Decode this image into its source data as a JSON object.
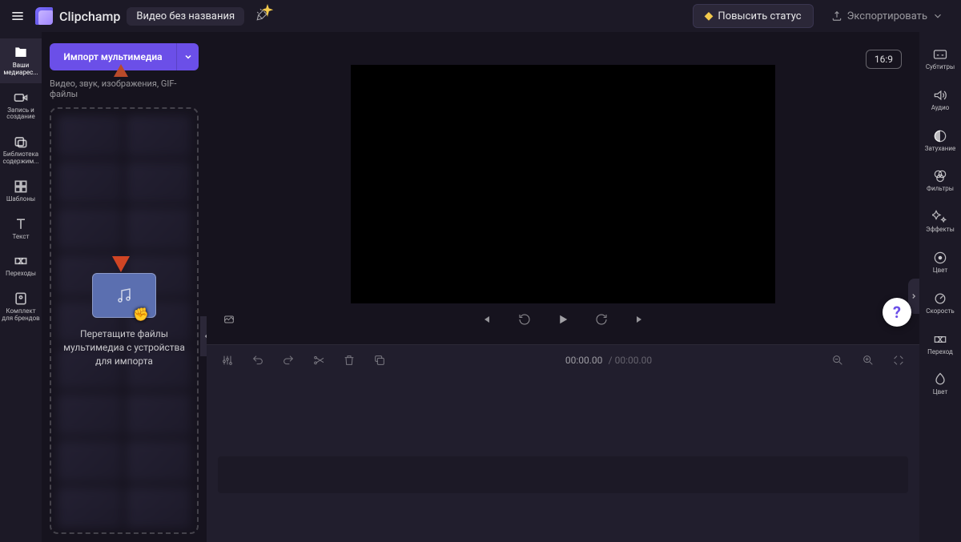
{
  "brand": "Clipchamp",
  "project_title": "Видео без названия",
  "header": {
    "upgrade": "Повысить статус",
    "export": "Экспортировать"
  },
  "left_rail": [
    {
      "key": "media",
      "label": "Ваши медиарес..."
    },
    {
      "key": "record",
      "label": "Запись и создание"
    },
    {
      "key": "library",
      "label": "Библиотека содержим..."
    },
    {
      "key": "templates",
      "label": "Шаблоны"
    },
    {
      "key": "text",
      "label": "Текст"
    },
    {
      "key": "transitions",
      "label": "Переходы"
    },
    {
      "key": "brandkit",
      "label": "Комплект для брендов"
    }
  ],
  "media_panel": {
    "import_button": "Импорт мультимедиа",
    "import_hint": "Видео, звук, изображения, GIF-файлы",
    "drop_text": "Перетащите файлы мультимедиа с устройства для импорта"
  },
  "preview": {
    "aspect": "16:9"
  },
  "timeline": {
    "current_time": "00:00.00",
    "total_time": "00:00.00"
  },
  "right_rail": [
    {
      "key": "captions",
      "label": "Субтитры"
    },
    {
      "key": "audio",
      "label": "Аудио"
    },
    {
      "key": "fade",
      "label": "Затухание"
    },
    {
      "key": "filters",
      "label": "Фильтры"
    },
    {
      "key": "effects",
      "label": "Эффекты"
    },
    {
      "key": "color",
      "label": "Цвет"
    },
    {
      "key": "speed",
      "label": "Скорость"
    },
    {
      "key": "transition",
      "label": "Переход"
    },
    {
      "key": "color2",
      "label": "Цвет"
    }
  ]
}
